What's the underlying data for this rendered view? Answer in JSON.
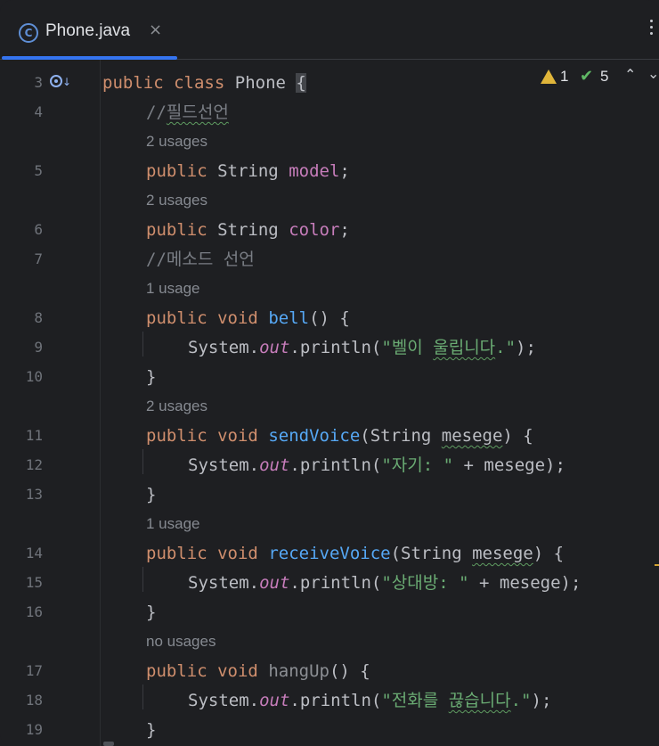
{
  "tab": {
    "title": "Phone.java",
    "icon": "C",
    "close": "×"
  },
  "inspection": {
    "warnings": "1",
    "weak_warnings": "5"
  },
  "lines": [
    {
      "num": "3"
    },
    {
      "num": "4"
    },
    {
      "num": "5"
    },
    {
      "num": "6"
    },
    {
      "num": "7"
    },
    {
      "num": "8"
    },
    {
      "num": "9"
    },
    {
      "num": "10"
    },
    {
      "num": "11"
    },
    {
      "num": "12"
    },
    {
      "num": "13"
    },
    {
      "num": "14"
    },
    {
      "num": "15"
    },
    {
      "num": "16"
    },
    {
      "num": "17"
    },
    {
      "num": "18"
    },
    {
      "num": "19"
    }
  ],
  "code": {
    "l3_kw1": "public",
    "l3_kw2": "class",
    "l3_name": "Phone",
    "l3_brace": "{",
    "l4_comment_prefix": "//",
    "l4_comment_text": "필드선언",
    "hint_model": "2 usages",
    "l5_kw": "public",
    "l5_type": "String",
    "l5_field": "model",
    "l5_end": ";",
    "hint_color": "2 usages",
    "l6_kw": "public",
    "l6_type": "String",
    "l6_field": "color",
    "l6_end": ";",
    "l7_comment": "//메소드 선언",
    "hint_bell": "1 usage",
    "l8_kw1": "public",
    "l8_kw2": "void",
    "l8_fn": "bell",
    "l8_rest": "() {",
    "l9_a": "System.",
    "l9_out": "out",
    "l9_b": ".println(",
    "l9_q1": "\"",
    "l9_s1": "벨이",
    "l9_sp": " ",
    "l9_s2": "울립니다",
    "l9_q2": ".\"",
    "l9_end": ");",
    "l10": "}",
    "hint_send": "2 usages",
    "l11_kw1": "public",
    "l11_kw2": "void",
    "l11_fn": "sendVoice",
    "l11_a": "(String ",
    "l11_param": "mesege",
    "l11_b": ") {",
    "l12_a": "System.",
    "l12_out": "out",
    "l12_b": ".println(",
    "l12_str": "\"자기: \"",
    "l12_c": " + mesege);",
    "l13": "}",
    "hint_receive": "1 usage",
    "l14_kw1": "public",
    "l14_kw2": "void",
    "l14_fn": "receiveVoice",
    "l14_a": "(String ",
    "l14_param": "mesege",
    "l14_b": ") {",
    "l15_a": "System.",
    "l15_out": "out",
    "l15_b": ".println(",
    "l15_str": "\"상대방: \"",
    "l15_c": " + mesege);",
    "l16": "}",
    "hint_hang": "no usages",
    "l17_kw1": "public",
    "l17_kw2": "void",
    "l17_fn": "hangUp",
    "l17_rest": "() {",
    "l18_a": "System.",
    "l18_out": "out",
    "l18_b": ".println(",
    "l18_q1": "\"전화를 ",
    "l18_s2": "끊습니다",
    "l18_q2": ".\"",
    "l18_end": ");",
    "l19": "}"
  }
}
